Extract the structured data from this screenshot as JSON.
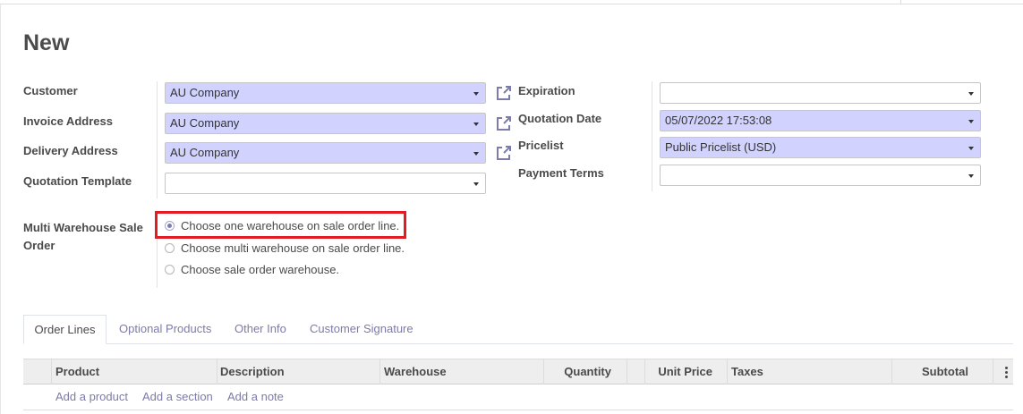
{
  "page": {
    "title": "New"
  },
  "left_fields": [
    {
      "label": "Customer",
      "value": "AU Company"
    },
    {
      "label": "Invoice Address",
      "value": "AU Company"
    },
    {
      "label": "Delivery Address",
      "value": "AU Company"
    },
    {
      "label": "Quotation Template",
      "value": ""
    }
  ],
  "right_fields": [
    {
      "label": "Expiration",
      "value": ""
    },
    {
      "label": "Quotation Date",
      "value": "05/07/2022 17:53:08"
    },
    {
      "label": "Pricelist",
      "value": "Public Pricelist (USD)"
    },
    {
      "label": "Payment Terms",
      "value": ""
    }
  ],
  "multi_warehouse": {
    "label_line1": "Multi Warehouse Sale",
    "label_line2": "Order",
    "options": [
      {
        "label": "Choose one warehouse on sale order line.",
        "selected": true
      },
      {
        "label": "Choose multi warehouse on sale order line.",
        "selected": false
      },
      {
        "label": "Choose sale order warehouse.",
        "selected": false
      }
    ]
  },
  "tabs": [
    {
      "label": "Order Lines",
      "active": true
    },
    {
      "label": "Optional Products",
      "active": false
    },
    {
      "label": "Other Info",
      "active": false
    },
    {
      "label": "Customer Signature",
      "active": false
    }
  ],
  "table": {
    "columns": [
      "Product",
      "Description",
      "Warehouse",
      "Quantity",
      "Unit Price",
      "Taxes",
      "Subtotal"
    ],
    "actions": [
      "Add a product",
      "Add a section",
      "Add a note"
    ]
  },
  "colors": {
    "required_field_bg": "#d2d2ff",
    "link": "#7c7bad",
    "highlight_border": "#e31b23"
  },
  "icons": {
    "external_link": "external-link-icon",
    "dropdown": "chevron-down-icon",
    "kebab": "kebab-menu-icon"
  }
}
